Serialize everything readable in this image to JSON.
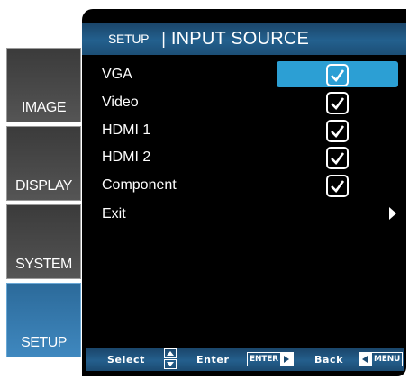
{
  "header": {
    "section": "SETUP",
    "separator": "|",
    "title": "INPUT SOURCE"
  },
  "sidebar": {
    "tabs": [
      {
        "label": "IMAGE",
        "active": false
      },
      {
        "label": "DISPLAY",
        "active": false
      },
      {
        "label": "SYSTEM",
        "active": false
      },
      {
        "label": "SETUP",
        "active": true
      }
    ]
  },
  "options": [
    {
      "label": "VGA",
      "checked": true,
      "selected": true
    },
    {
      "label": "Video",
      "checked": true
    },
    {
      "label": "HDMI 1",
      "checked": true
    },
    {
      "label": "HDMI 2",
      "checked": true
    },
    {
      "label": "Component",
      "checked": true
    },
    {
      "label": "Exit",
      "icon": "arrow-right-icon"
    }
  ],
  "footer": {
    "select_label": "Select",
    "enter_label": "Enter",
    "enter_key": "ENTER",
    "back_label": "Back",
    "menu_key": "MENU"
  },
  "colors": {
    "panel": "#000000",
    "header": "#23608e",
    "highlight": "#2c9fd4",
    "active_tab": "#3f88bf",
    "inactive_tab": "#4a4a4a"
  }
}
